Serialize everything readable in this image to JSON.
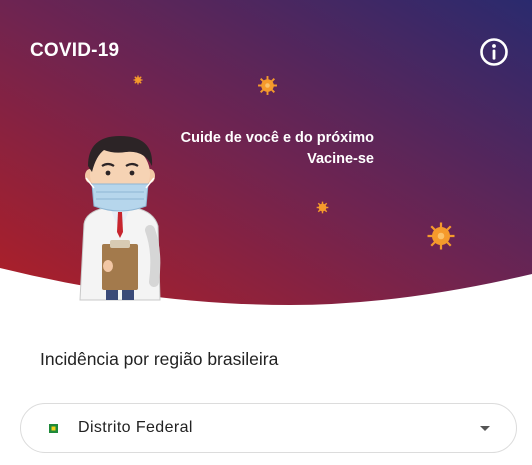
{
  "header": {
    "title": "COVID-19",
    "info_icon": "info-icon",
    "gradient_colors": [
      "#b01f26",
      "#6e2451",
      "#2a2a6e"
    ]
  },
  "banner": {
    "line1": "Cuide de você e do próximo",
    "line2": "Vacine-se",
    "illustration": "doctor-with-mask",
    "virus_color": "#f59a2c"
  },
  "section": {
    "title": "Incidência por região brasileira"
  },
  "region_select": {
    "selected": "Distrito Federal",
    "flag_icon": "distrito-federal-flag-icon",
    "dropdown_icon": "chevron-down-icon"
  }
}
